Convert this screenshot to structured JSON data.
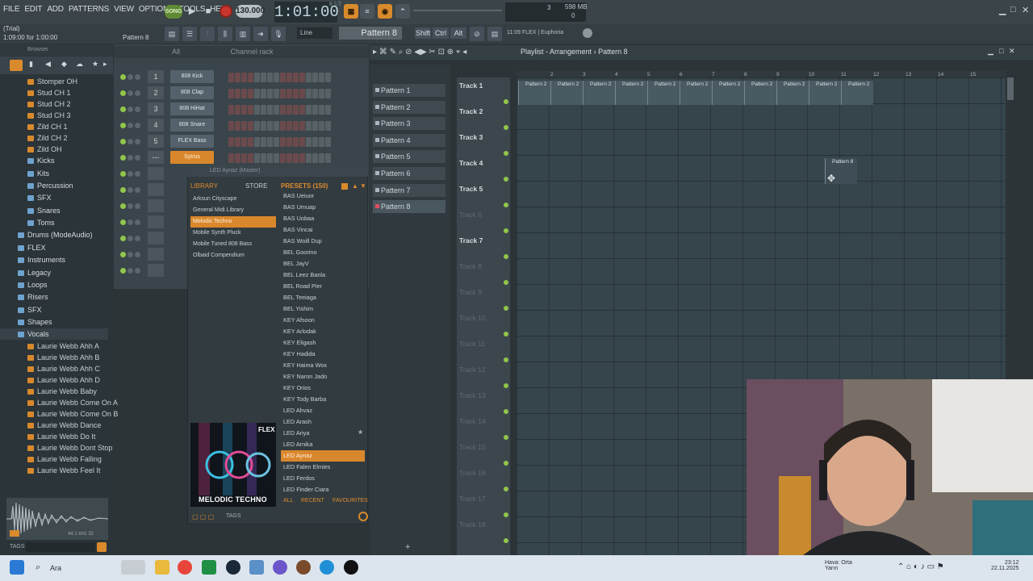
{
  "menu": [
    "FILE",
    "EDIT",
    "ADD",
    "PATTERNS",
    "VIEW",
    "OPTIONS",
    "TOOLS",
    "HELP"
  ],
  "transport": {
    "song_mode_label": "SONG",
    "tempo": "130.000",
    "time": "1:01:00",
    "time_unit": "B:S:T",
    "cpu": "3",
    "cpu_zero": "0",
    "memory": "598 MB"
  },
  "toolbar2": {
    "trial": "(Trial)",
    "trial_time": "1:09:00 for 1:00:00",
    "pattern_small": "Pattern 8",
    "snap": "Line",
    "pattern_selector": "Pattern 8",
    "keys": [
      "Shift",
      "Ctrl",
      "Alt"
    ],
    "hint": "11:09  FLEX | Euphoria"
  },
  "browser": {
    "title": "Browser",
    "items": [
      {
        "label": "Stomper OH",
        "type": "file"
      },
      {
        "label": "Stud CH 1",
        "type": "file"
      },
      {
        "label": "Stud CH 2",
        "type": "file"
      },
      {
        "label": "Stud CH 3",
        "type": "file"
      },
      {
        "label": "Zild CH 1",
        "type": "file"
      },
      {
        "label": "Zild CH 2",
        "type": "file"
      },
      {
        "label": "Zild OH",
        "type": "file"
      },
      {
        "label": "Kicks",
        "type": "folder"
      },
      {
        "label": "Kits",
        "type": "folder"
      },
      {
        "label": "Percussion",
        "type": "folder"
      },
      {
        "label": "SFX",
        "type": "folder"
      },
      {
        "label": "Snares",
        "type": "folder"
      },
      {
        "label": "Toms",
        "type": "folder"
      },
      {
        "label": "Drums (ModeAudio)",
        "type": "root"
      },
      {
        "label": "FLEX",
        "type": "root"
      },
      {
        "label": "Instruments",
        "type": "root"
      },
      {
        "label": "Legacy",
        "type": "root"
      },
      {
        "label": "Loops",
        "type": "root"
      },
      {
        "label": "Risers",
        "type": "root"
      },
      {
        "label": "SFX",
        "type": "root"
      },
      {
        "label": "Shapes",
        "type": "root"
      },
      {
        "label": "Vocals",
        "type": "root"
      },
      {
        "label": "Laurie Webb Ahh A",
        "type": "file"
      },
      {
        "label": "Laurie Webb Ahh B",
        "type": "file"
      },
      {
        "label": "Laurie Webb Ahh C",
        "type": "file"
      },
      {
        "label": "Laurie Webb Ahh D",
        "type": "file"
      },
      {
        "label": "Laurie Webb Baby",
        "type": "file"
      },
      {
        "label": "Laurie Webb Come On A",
        "type": "file"
      },
      {
        "label": "Laurie Webb Come On B",
        "type": "file"
      },
      {
        "label": "Laurie Webb Dance",
        "type": "file"
      },
      {
        "label": "Laurie Webb Do It",
        "type": "file"
      },
      {
        "label": "Laurie Webb Dont Stop",
        "type": "file"
      },
      {
        "label": "Laurie Webb Falling",
        "type": "file"
      },
      {
        "label": "Laurie Webb Feel It",
        "type": "file"
      }
    ],
    "wave_meta": "44.1 kHz 32",
    "tags_label": "TAGS"
  },
  "channel_rack": {
    "title": "Channel rack",
    "group": "All",
    "channels": [
      {
        "num": "1",
        "name": "808 Kick"
      },
      {
        "num": "2",
        "name": "808 Clap"
      },
      {
        "num": "3",
        "name": "808 HiHat"
      },
      {
        "num": "4",
        "name": "808 Snare"
      },
      {
        "num": "5",
        "name": "FLEX Bass"
      },
      {
        "num": "---",
        "name": "Sytrus"
      }
    ]
  },
  "flex": {
    "title": "LED Aynaz (Master)",
    "tab_library": "LIBRARY",
    "tab_store": "STORE",
    "presets_header": "PRESETS (150)",
    "libraries": [
      "Arksun Cityscape",
      "General Midi Library",
      "Melodic Techno",
      "Mobile Synth Pluck",
      "Mobile Tuned 808 Bass",
      "Olbaid Compendium"
    ],
    "presets": [
      "BAS Ueiuor",
      "BAS Umuap",
      "BAS Uobaa",
      "BAS Vincai",
      "BAS Woill Dup",
      "BEL Goorino",
      "BEL JayV",
      "BEL Leez Banla",
      "BEL Road Pier",
      "BEL Teeiaga",
      "BEL Yishim",
      "KEY Afsoon",
      "KEY Arlodak",
      "KEY Eligash",
      "KEY Hadida",
      "KEY Haima Wox",
      "KEY Naron Jado",
      "KEY Orios",
      "KEY Tody Barba",
      "LED Ahvaz",
      "LED Arash",
      "LED Ariya",
      "LED Arnika",
      "LED Aynaz",
      "LED Falen Elmies",
      "LED Ferdos",
      "LED Finder Ciara"
    ],
    "art_title": "MELODIC TECHNO",
    "art_logo": "FLEX",
    "bottom_tabs": [
      "ALL",
      "RECENT",
      "FAVOURITES"
    ],
    "tags": "TAGS"
  },
  "patterns": [
    "Pattern 1",
    "Pattern 2",
    "Pattern 3",
    "Pattern 4",
    "Pattern 5",
    "Pattern 6",
    "Pattern 7",
    "Pattern 8"
  ],
  "playlist": {
    "title": "Playlist - Arrangement",
    "breadcrumb": "Pattern 8",
    "bars": [
      "2",
      "3",
      "4",
      "5",
      "6",
      "7",
      "8",
      "9",
      "10",
      "11",
      "12",
      "13",
      "14",
      "15"
    ],
    "tracks": [
      "Track 1",
      "Track 2",
      "Track 3",
      "Track 4",
      "Track 5",
      "Track 6",
      "Track 7",
      "Track 8",
      "Track 9",
      "Track 10",
      "Track 11",
      "Track 12",
      "Track 13",
      "Track 14",
      "Track 15",
      "Track 16",
      "Track 17",
      "Track 18"
    ],
    "clip_label": "Pattern 2",
    "ghost_label": "Pattern 8"
  },
  "taskbar": {
    "search": "Ara",
    "weather_line1": "Hava: Orta",
    "weather_line2": "Yarın",
    "time": "23:12",
    "date": "22.11.2025"
  }
}
